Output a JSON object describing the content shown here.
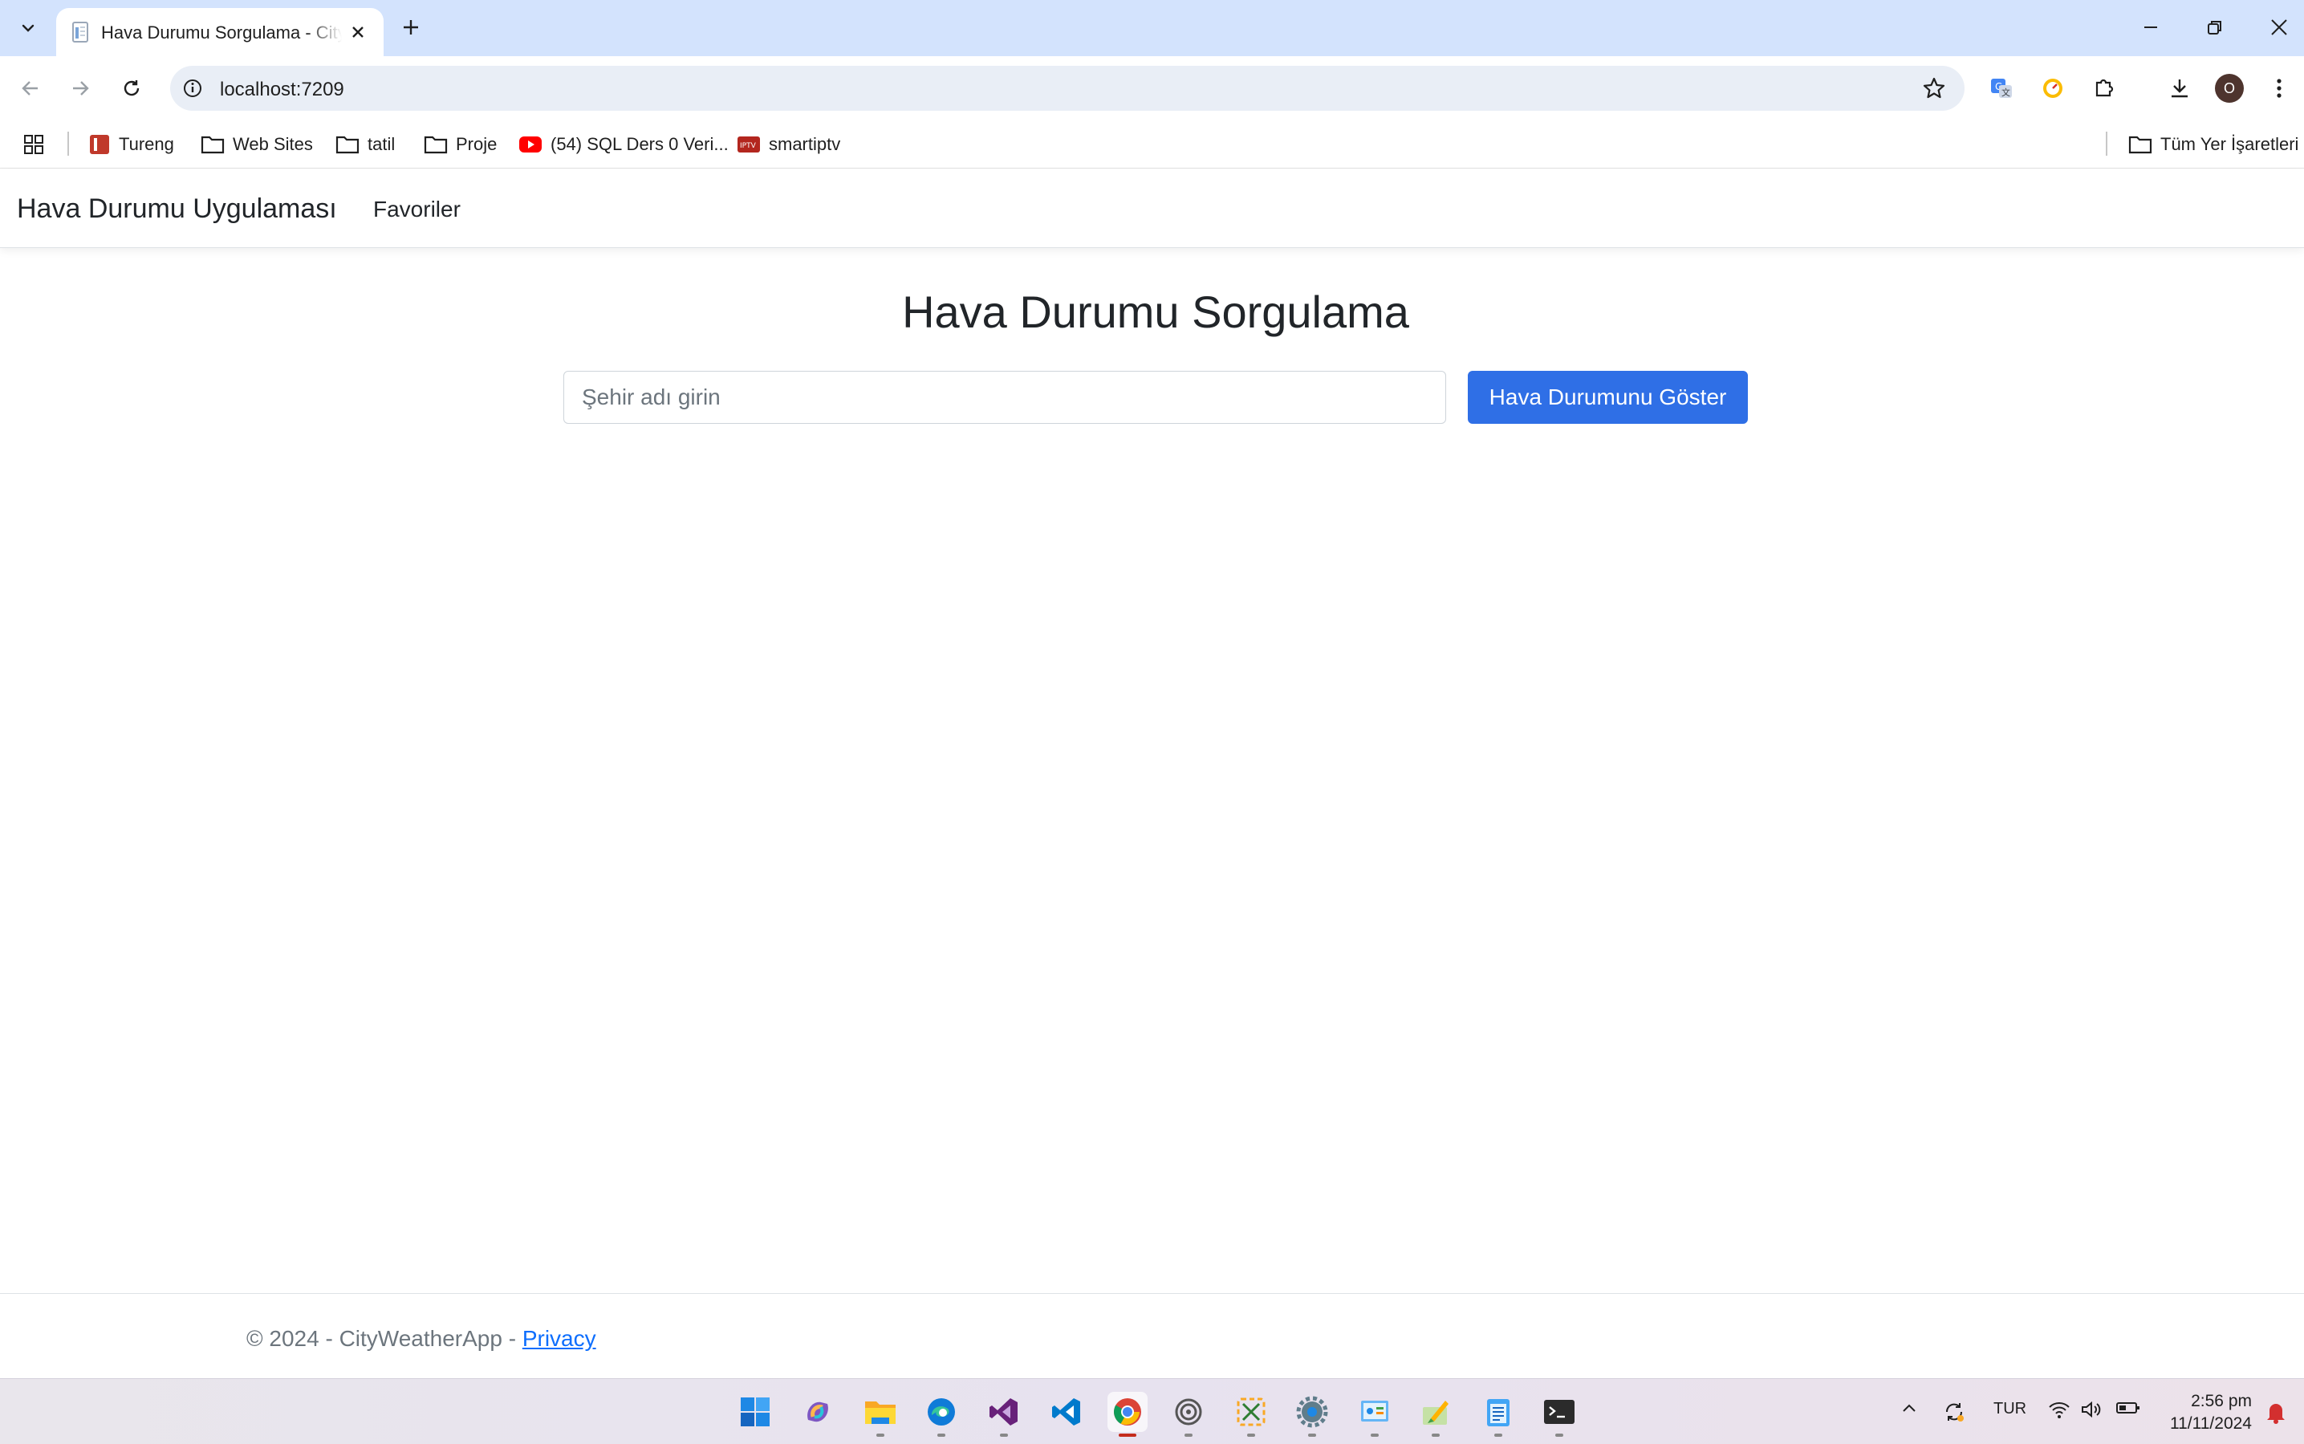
{
  "browser": {
    "tab_title": "Hava Durumu Sorgulama - CityWeatherApp",
    "url": "localhost:7209",
    "bookmarks": [
      {
        "label": "Tureng",
        "icon": "tureng-icon"
      },
      {
        "label": "Web Sites",
        "icon": "folder-icon"
      },
      {
        "label": "tatil",
        "icon": "folder-icon"
      },
      {
        "label": "Proje",
        "icon": "folder-icon"
      },
      {
        "label": "(54) SQL Ders 0 Veri...",
        "icon": "youtube-icon"
      },
      {
        "label": "smartiptv",
        "icon": "smartiptv-icon"
      }
    ],
    "all_bookmarks_label": "Tüm Yer İşaretleri",
    "profile_initial": "O"
  },
  "app": {
    "brand": "Hava Durumu Uygulaması",
    "nav_favorites": "Favoriler",
    "heading": "Hava Durumu Sorgulama",
    "city_placeholder": "Şehir adı girin",
    "show_button": "Hava Durumunu Göster",
    "footer_text": "© 2024 - CityWeatherApp - ",
    "footer_link": "Privacy"
  },
  "taskbar": {
    "language": "TUR",
    "time": "2:56 pm",
    "date": "11/11/2024",
    "apps": [
      "start-icon",
      "copilot-icon",
      "file-explorer-icon",
      "edge-icon",
      "visual-studio-icon",
      "vscode-icon",
      "chrome-icon",
      "app-icon",
      "snipping-tool-icon",
      "settings-icon",
      "control-panel-icon",
      "paint-icon",
      "notepad-icon",
      "terminal-icon"
    ]
  },
  "colors": {
    "primary_button": "#2f6fe6",
    "tabstrip": "#d3e3fd",
    "link": "#0d6efd"
  }
}
